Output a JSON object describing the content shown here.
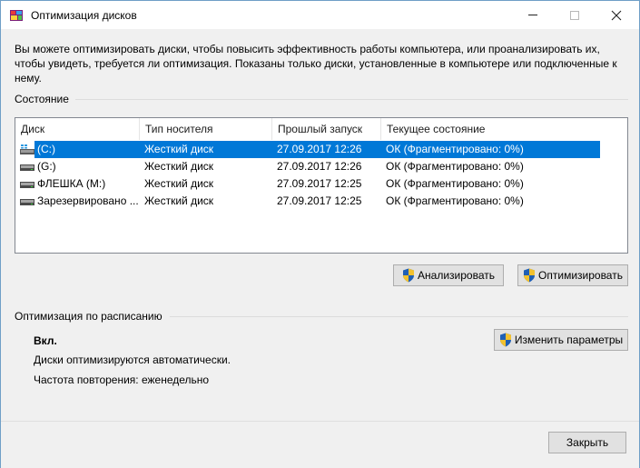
{
  "window": {
    "title": "Оптимизация дисков",
    "icon": "defrag-app-icon",
    "controls": [
      "minimize-icon",
      "maximize-icon",
      "close-icon"
    ]
  },
  "intro_text": "Вы можете оптимизировать диски, чтобы повысить эффективность работы  компьютера, или проанализировать их, чтобы увидеть, требуется ли оптимизация. Показаны только диски, установленные в компьютере или подключенные к нему.",
  "status_section": {
    "title": "Состояние",
    "columns": [
      "Диск",
      "Тип носителя",
      "Прошлый запуск",
      "Текущее состояние"
    ],
    "drives": [
      {
        "name": "(C:)",
        "media": "Жесткий диск",
        "last_run": "27.09.2017 12:26",
        "state": "ОК (Фрагментировано: 0%)",
        "icon": "windows-drive-icon",
        "selected": true
      },
      {
        "name": "(G:)",
        "media": "Жесткий диск",
        "last_run": "27.09.2017 12:26",
        "state": "ОК (Фрагментировано: 0%)",
        "icon": "drive-icon",
        "selected": false
      },
      {
        "name": "ФЛЕШКА (M:)",
        "media": "Жесткий диск",
        "last_run": "27.09.2017 12:25",
        "state": "ОК (Фрагментировано: 0%)",
        "icon": "drive-icon",
        "selected": false
      },
      {
        "name": "Зарезервировано ...",
        "media": "Жесткий диск",
        "last_run": "27.09.2017 12:25",
        "state": "ОК (Фрагментировано: 0%)",
        "icon": "drive-icon",
        "selected": false
      }
    ],
    "analyze_label": "Анализировать",
    "optimize_label": "Оптимизировать"
  },
  "schedule_section": {
    "title": "Оптимизация по расписанию",
    "status": "Вкл.",
    "description": "Диски оптимизируются автоматически.",
    "frequency": "Частота повторения: еженедельно",
    "change_label": "Изменить параметры"
  },
  "footer": {
    "close_label": "Закрыть"
  },
  "colors": {
    "selection": "#0078d7",
    "button_face": "#e1e1e1",
    "window_bg": "#f0f0f0"
  }
}
